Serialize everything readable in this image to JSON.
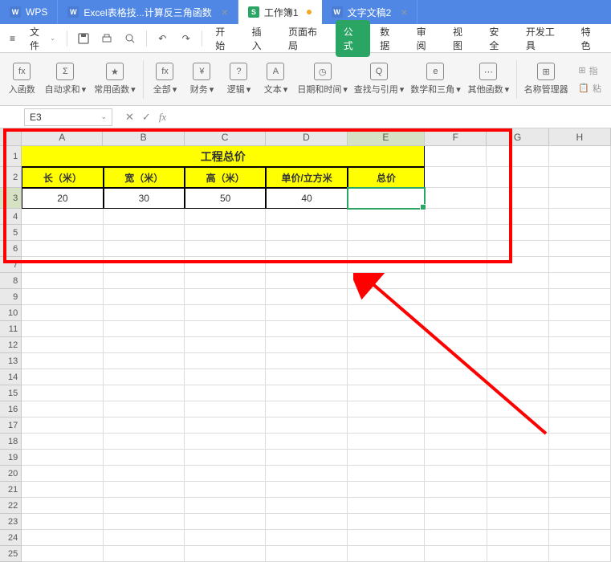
{
  "tabs": [
    {
      "icon": "W",
      "label": "WPS"
    },
    {
      "icon": "W",
      "label": "Excel表格技...计算反三角函数",
      "close": "×"
    },
    {
      "icon": "S",
      "label": "工作簿1",
      "active": true,
      "modified": true
    },
    {
      "icon": "W",
      "label": "文字文稿2",
      "close": "×"
    }
  ],
  "menubar": {
    "hamburger": "≡",
    "file": "文件",
    "dd": "⌄",
    "items": [
      "开始",
      "插入",
      "页面布局",
      "公式",
      "数据",
      "审阅",
      "视图",
      "安全",
      "开发工具",
      "特色"
    ],
    "active_index": 3
  },
  "ribbon": {
    "buttons": [
      {
        "icon": "fx",
        "label": "入函数"
      },
      {
        "icon": "Σ",
        "label": "自动求和",
        "dd": true
      },
      {
        "icon": "★",
        "label": "常用函数",
        "dd": true
      },
      {
        "icon": "fx",
        "label": "全部",
        "dd": true
      },
      {
        "icon": "¥",
        "label": "财务",
        "dd": true
      },
      {
        "icon": "?",
        "label": "逻辑",
        "dd": true
      },
      {
        "icon": "A",
        "label": "文本",
        "dd": true
      },
      {
        "icon": "◷",
        "label": "日期和时间",
        "dd": true
      },
      {
        "icon": "Q",
        "label": "查找与引用",
        "dd": true
      },
      {
        "icon": "e",
        "label": "数学和三角",
        "dd": true
      },
      {
        "icon": "⋯",
        "label": "其他函数",
        "dd": true
      }
    ],
    "side": [
      {
        "icon": "⊞",
        "label": "名称管理器"
      },
      {
        "icon": "📋",
        "label": "粘"
      }
    ],
    "side_top": [
      {
        "icon": "⊞",
        "label": "指"
      }
    ]
  },
  "namebox": {
    "value": "E3",
    "dd": "⌄"
  },
  "fx": {
    "cancel": "✕",
    "confirm": "✓",
    "label": "fx"
  },
  "columns": [
    "A",
    "B",
    "C",
    "D",
    "E",
    "F",
    "G",
    "H"
  ],
  "sheet": {
    "title": "工程总价",
    "headers": [
      "长（米）",
      "宽（米）",
      "高（米）",
      "单价/立方米",
      "总价"
    ],
    "values": [
      "20",
      "30",
      "50",
      "40",
      ""
    ]
  },
  "active": {
    "col": "E",
    "row": 3
  }
}
